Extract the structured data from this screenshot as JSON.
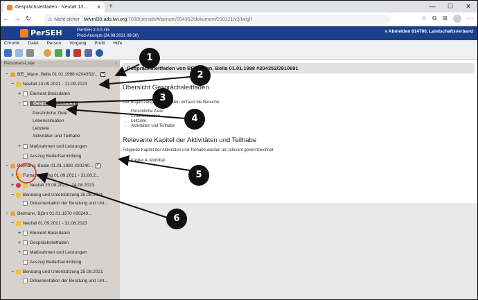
{
  "browser": {
    "tab_title": "Gesprächsleitfaden - Neufall 13....",
    "tab_close": "✕",
    "new_tab": "+",
    "not_secure": "Nicht sicher",
    "url_host": "lwlvml39.ads.lwl.org",
    "url_path": ":7038/perseh/#/person/204352/dokument/210121/v3/lwlglf",
    "window_minimize": "—",
    "window_maximize": "☐",
    "window_close": "✕"
  },
  "app": {
    "name": "PerSEH",
    "version_line1": "PerSEH 2.3.0-r15",
    "version_line2": "Prod-Anonym (24.08.2021 09:30)",
    "user_info": "Abmelden 814700, Landschaftsverband"
  },
  "menu": [
    "Chronik",
    "Datei",
    "Person",
    "Vorgang",
    "Profil",
    "Hilfe"
  ],
  "sidebar": {
    "header": "Personen-Liste",
    "collapse_icon": "‹",
    "nodes": [
      {
        "label": "BEI_Mann, Bella 01.01.1998 #204352/...",
        "toggle": "−"
      },
      {
        "label": "Neufall 13.09.2021 - 12.09.2023",
        "toggle": "−"
      },
      {
        "label": "Element Basisdaten",
        "toggle": "+"
      },
      {
        "label": "Gesprächsleitfaden",
        "toggle": "−"
      },
      {
        "label": "Persönliche Ziele",
        "toggle": ""
      },
      {
        "label": "Lebenssituation",
        "toggle": ""
      },
      {
        "label": "Leitziele",
        "toggle": ""
      },
      {
        "label": "Aktivitäten und Teilhabe",
        "toggle": ""
      },
      {
        "label": "Maßnahmen und Leistungen",
        "toggle": "+"
      },
      {
        "label": "Auszug Bedarfsermittlung",
        "toggle": ""
      },
      {
        "label": "Beimann, Beate 01.01.1980 #20240...",
        "toggle": "−"
      },
      {
        "label": "Fortschreibung 01.09.2021 - 31.08.2...",
        "toggle": "+"
      },
      {
        "label": "Neufall 25.08.2021 - 24.08.2023",
        "toggle": "+"
      },
      {
        "label": "Beratung und Unterstützung 25.08.2021",
        "toggle": "−"
      },
      {
        "label": "Dokumentation der Beratung und Unt...",
        "toggle": ""
      },
      {
        "label": "Beimann, Björn 01.01.1970 #20240...",
        "toggle": "−"
      },
      {
        "label": "Neufall 01.09.2021 - 31.08.2023",
        "toggle": "−"
      },
      {
        "label": "Element Basisdaten",
        "toggle": "+"
      },
      {
        "label": "Gesprächsleitfaden",
        "toggle": "+"
      },
      {
        "label": "Maßnahmen und Leistungen",
        "toggle": "+"
      },
      {
        "label": "Auszug Bedarfsermittlung",
        "toggle": ""
      },
      {
        "label": "Beratung und Unterstützung 25.08.2021",
        "toggle": "−"
      },
      {
        "label": "Dokumentation der Beratung und Unt...",
        "toggle": ""
      }
    ]
  },
  "main": {
    "title": "Gesprächsleitfaden von BEI_Mann, Bella 01.01.1998 #204352/2910691",
    "section1_heading": "Übersicht Gesprächsleitfaden",
    "section1_intro": "Der Bogen Gesprächsleitfaden umfasst die Bereiche",
    "section1_items": [
      "Persönliche Ziele",
      "Lebenssituation",
      "Leitziele",
      "Aktivitäten und Teilhabe"
    ],
    "section2_heading": "Relevante Kapitel der Aktivitäten und Teilhabe",
    "section2_intro": "Folgende Kapitel der Aktivitäten und Teilhabe wurden als relevant gekennzeichnet",
    "section2_items": [
      "Kapitel 4: Mobilität"
    ]
  },
  "callouts": [
    "1",
    "2",
    "3",
    "4",
    "5",
    "6"
  ],
  "colors": {
    "header_bg": "#1b3f8b",
    "sidebar_bg": "#d7d2cd",
    "selected_bg": "#6e6964",
    "highlight_circle": "#e02020"
  }
}
